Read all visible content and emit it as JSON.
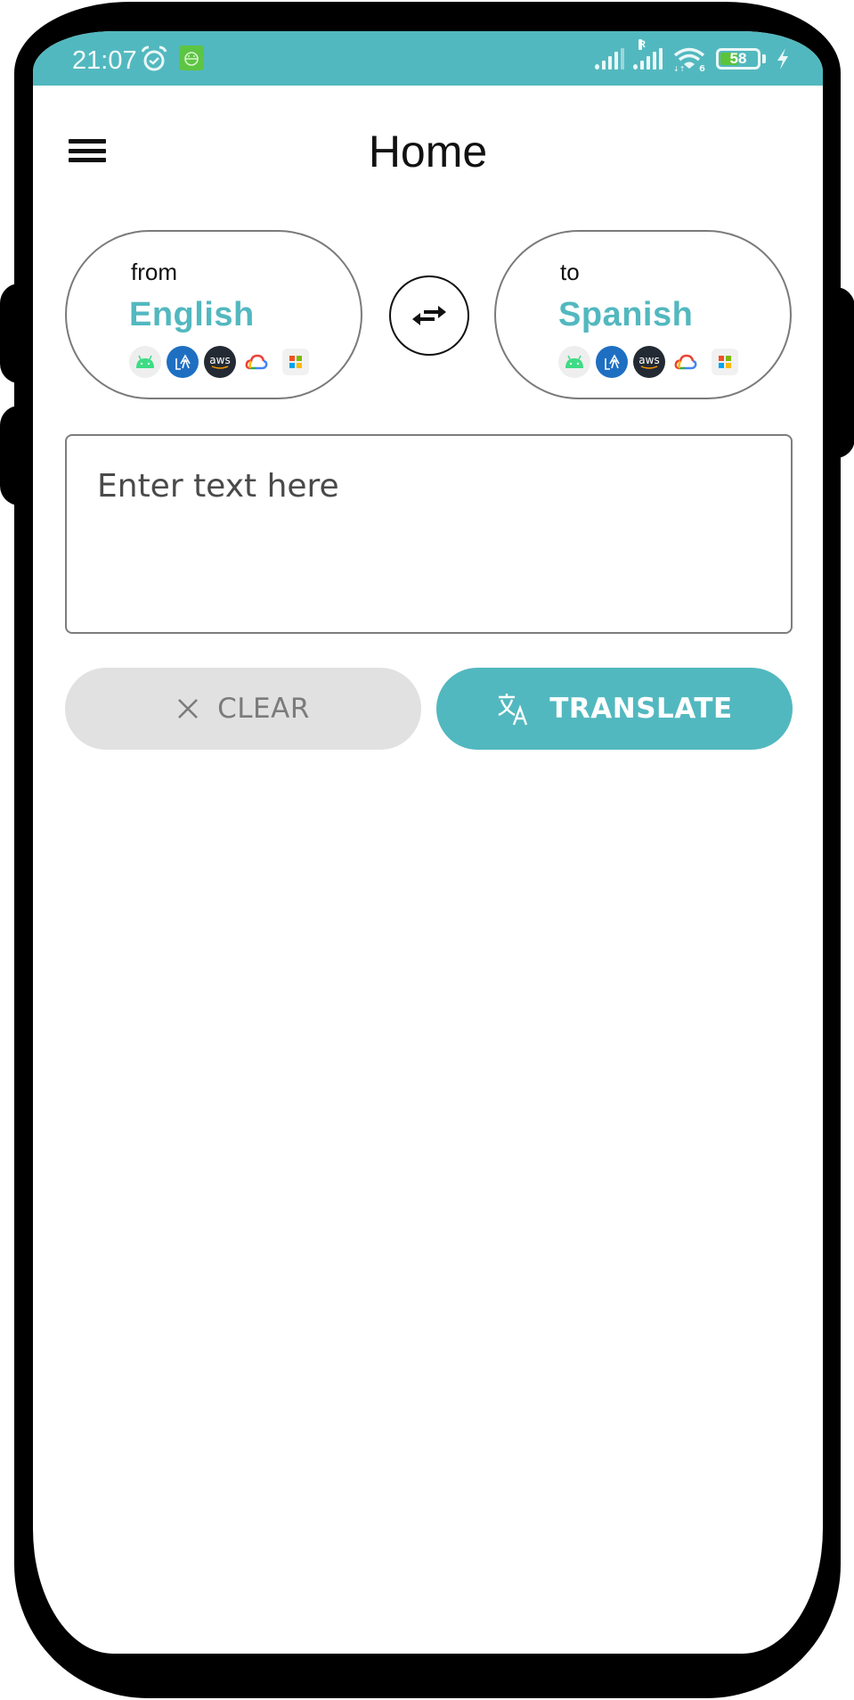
{
  "status_bar": {
    "time": "21:07",
    "icons": [
      "alarm-icon",
      "app-notification-icon",
      "signal-icon",
      "signal-roaming-icon",
      "wifi-6-icon",
      "battery-icon",
      "charging-icon"
    ],
    "roaming_label": "R",
    "wifi_label": "6",
    "battery_level": "58",
    "color": "#52B8BF"
  },
  "app_bar": {
    "title": "Home",
    "menu_icon": "hamburger-menu-icon"
  },
  "language_selector": {
    "source": {
      "label": "from",
      "language": "English"
    },
    "target": {
      "label": "to",
      "language": "Spanish"
    },
    "providers": [
      "android-icon",
      "azure-translator-icon",
      "aws-icon",
      "google-cloud-icon",
      "microsoft-icon"
    ],
    "aws_text": "aws",
    "swap_icon": "swap-arrows-icon"
  },
  "input": {
    "placeholder": "Enter text here",
    "value": ""
  },
  "actions": {
    "clear_label": "CLEAR",
    "translate_label": "TRANSLATE",
    "clear_icon": "close-icon",
    "translate_icon": "translate-icon"
  },
  "colors": {
    "accent": "#52B8BF",
    "clear_bg": "#E1E1E1",
    "clear_text": "#7B7B7B"
  }
}
